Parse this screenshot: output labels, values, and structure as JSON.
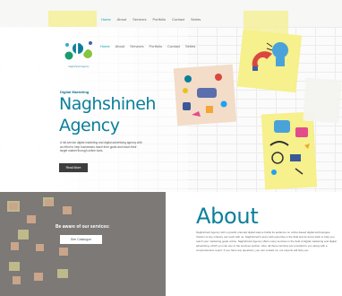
{
  "brand": {
    "logo_text": "Naghshineh Agency"
  },
  "top_nav": [
    "Home",
    "About",
    "Services",
    "Portfolio",
    "Contact",
    "Series"
  ],
  "main_nav": [
    "Home",
    "About",
    "Services",
    "Portfolio",
    "Contact",
    "Series"
  ],
  "hero": {
    "kicker": "Digital Marketing",
    "title_line1": "Naghshineh",
    "title_line2": "Agency",
    "intro": "A full-service digital marketing and digital advertising agency with an effort to help businesses reach their goals and reach their target market through online tools.",
    "button": "Read More"
  },
  "catalogue": {
    "heading": "Be aware of our services:",
    "button": "See Catalogue"
  },
  "about": {
    "title": "About",
    "body": "Naghshineh Agency with a growth-oriented digital stance builds its audience on online-based digital technologies. Visitors of any industry can work with us. Naghshineh's team with expertise in the field and its focus back to help you reach your marketing goals online. Naghshineh Agency offers many services in the field of digital marketing and digital advertising, which you can see in the services section. Also, all these services are provided to you along with a comprehensive report. If you have any questions, you can contact us, our experts will help you."
  },
  "colors": {
    "brand": "#0b7f9a",
    "accent": "#0aa1a8",
    "note": "#f4f09e",
    "button": "#3d3d3d"
  }
}
